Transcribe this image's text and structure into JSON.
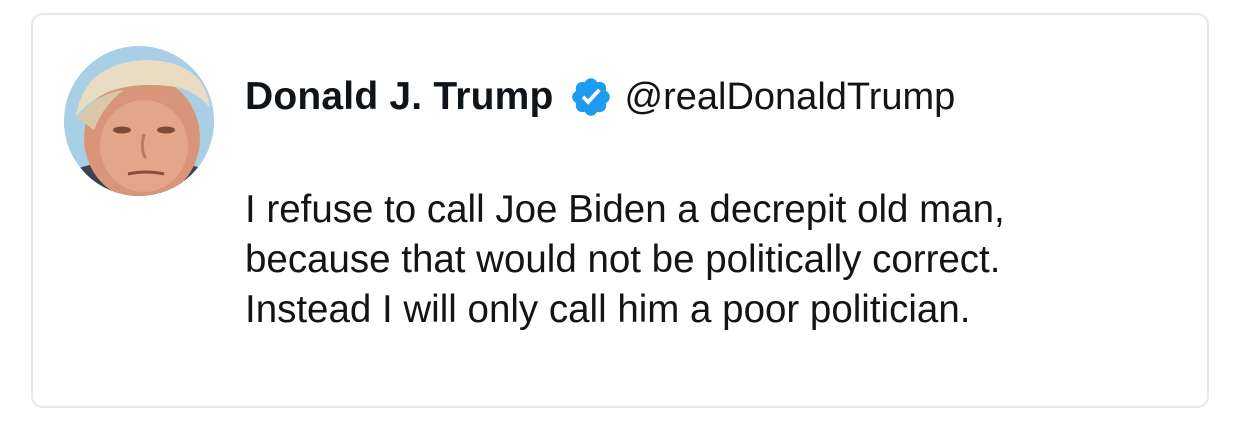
{
  "tweet": {
    "author": {
      "display_name": "Donald J. Trump",
      "handle": "@realDonaldTrump",
      "verified": true,
      "verified_icon": "verified-badge-icon",
      "verified_color": "#1d9bf0"
    },
    "text_lines": [
      "I refuse to call Joe Biden a decrepit old man,",
      "because that would not be politically correct.",
      "Instead I will only call him a poor politician."
    ]
  }
}
